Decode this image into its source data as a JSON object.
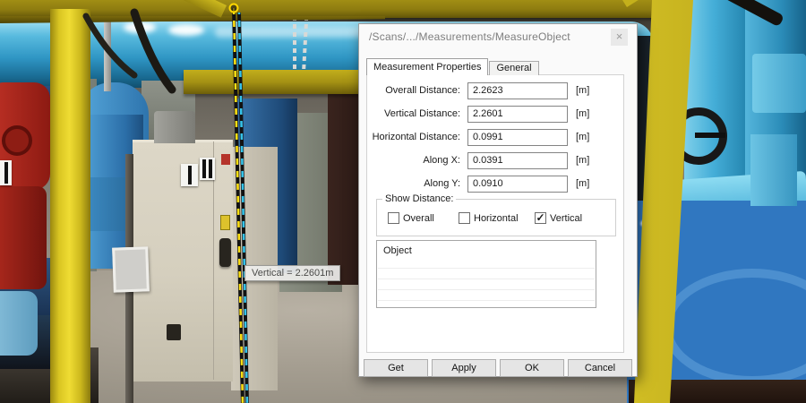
{
  "dialog": {
    "title": "/Scans/.../Measurements/MeasureObject",
    "close_label": "×",
    "tabs": {
      "properties": "Measurement Properties",
      "general": "General"
    },
    "fields": [
      {
        "label": "Overall Distance:",
        "value": "2.2623",
        "unit": "[m]"
      },
      {
        "label": "Vertical Distance:",
        "value": "2.2601",
        "unit": "[m]"
      },
      {
        "label": "Horizontal Distance:",
        "value": "0.0991",
        "unit": "[m]"
      },
      {
        "label": "Along X:",
        "value": "0.0391",
        "unit": "[m]"
      },
      {
        "label": "Along Y:",
        "value": "0.0910",
        "unit": "[m]"
      }
    ],
    "show_distance": {
      "legend": "Show Distance:",
      "options": [
        {
          "label": "Overall",
          "checked": false,
          "mark": ""
        },
        {
          "label": "Horizontal",
          "checked": false,
          "mark": ""
        },
        {
          "label": "Vertical",
          "checked": true,
          "mark": "✓"
        }
      ]
    },
    "list": {
      "header": "Object"
    },
    "buttons": {
      "get": "Get",
      "apply": "Apply",
      "ok": "OK",
      "cancel": "Cancel"
    }
  },
  "scene": {
    "measure_tooltip": "Vertical = 2.2601m",
    "colors": {
      "measure_line_yellow": "#ffe013",
      "measure_line_cyan": "#35c3ea",
      "frame_yellow": "#e3cf28",
      "pipe_cyan": "#2f96c4",
      "pipe_blue": "#2b6ea8",
      "cabinet_cream": "#d5cfbe",
      "tank_blue": "#3077c0"
    }
  }
}
